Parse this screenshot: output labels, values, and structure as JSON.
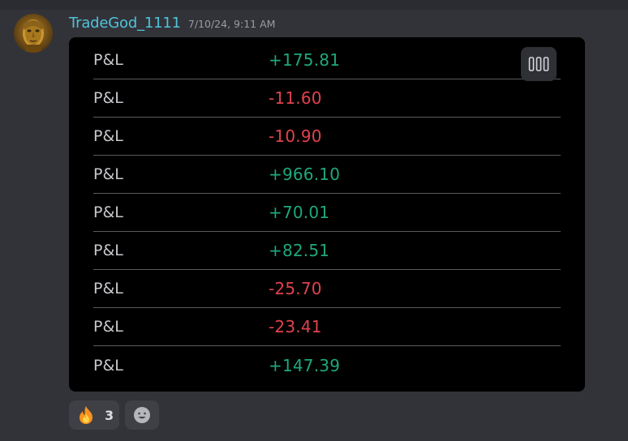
{
  "message": {
    "username": "TradeGod_1111",
    "timestamp": "7/10/24, 9:11 AM",
    "avatar_icon": "bronze-face-avatar"
  },
  "pl_rows": [
    {
      "label": "P&L",
      "value": "+175.81",
      "sign": "positive"
    },
    {
      "label": "P&L",
      "value": "-11.60",
      "sign": "negative"
    },
    {
      "label": "P&L",
      "value": "-10.90",
      "sign": "negative"
    },
    {
      "label": "P&L",
      "value": "+966.10",
      "sign": "positive"
    },
    {
      "label": "P&L",
      "value": "+70.01",
      "sign": "positive"
    },
    {
      "label": "P&L",
      "value": "+82.51",
      "sign": "positive"
    },
    {
      "label": "P&L",
      "value": "-25.70",
      "sign": "negative"
    },
    {
      "label": "P&L",
      "value": "-23.41",
      "sign": "negative"
    },
    {
      "label": "P&L",
      "value": "+147.39",
      "sign": "positive"
    }
  ],
  "column_button_icon": "columns-icon",
  "reactions": [
    {
      "emoji": "🔥",
      "icon": "fire-icon",
      "count": "3"
    },
    {
      "icon": "add-reaction-smiley-icon"
    }
  ],
  "colors": {
    "background": "#323339",
    "embed_background": "#000000",
    "username": "#4fc3d9",
    "positive": "#1fa77c",
    "negative": "#e0424e",
    "label": "#c7c8cc"
  }
}
